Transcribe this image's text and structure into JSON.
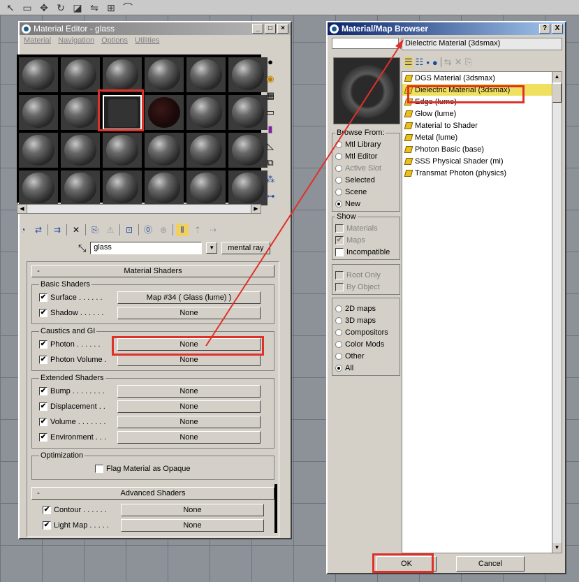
{
  "material_editor": {
    "title": "Material Editor - glass",
    "menus": [
      "Material",
      "Navigation",
      "Options",
      "Utilities"
    ],
    "material_name": "glass",
    "material_type": "mental ray",
    "rollouts": {
      "material_shaders": {
        "minus": "-",
        "title": "Material Shaders",
        "groups": [
          {
            "title": "Basic Shaders",
            "rows": [
              {
                "label": "Surface . . . . . .",
                "checked": "✔",
                "value": "Map #34  ( Glass (lume) )"
              },
              {
                "label": "Shadow . . . . . .",
                "checked": "✔",
                "value": "None"
              }
            ]
          },
          {
            "title": "Caustics and GI",
            "rows": [
              {
                "label": "Photon . . . . . .",
                "checked": "✔",
                "value": "None"
              },
              {
                "label": "Photon Volume .",
                "checked": "✔",
                "value": "None"
              }
            ]
          },
          {
            "title": "Extended Shaders",
            "rows": [
              {
                "label": "Bump . . . . . . . .",
                "checked": "✔",
                "value": "None"
              },
              {
                "label": "Displacement . .",
                "checked": "✔",
                "value": "None"
              },
              {
                "label": "Volume . . . . . . .",
                "checked": "✔",
                "value": "None"
              },
              {
                "label": "Environment . . .",
                "checked": "✔",
                "value": "None"
              }
            ]
          }
        ],
        "optimization": {
          "title": "Optimization",
          "label": "Flag Material as Opaque"
        }
      },
      "advanced_shaders": {
        "minus": "-",
        "title": "Advanced Shaders",
        "rows": [
          {
            "label": "Contour . . . . . .",
            "checked": "✔",
            "value": "None"
          },
          {
            "label": "Light Map . . . . .",
            "checked": "✔",
            "value": "None"
          }
        ]
      }
    }
  },
  "browser": {
    "title": "Material/Map Browser",
    "help_button": "?",
    "close_button": "X",
    "selected_name": "Dielectric Material (3dsmax)",
    "items": [
      "DGS Material (3dsmax)",
      "Dielectric Material (3dsmax)",
      "Edge (lume)",
      "Glow (lume)",
      "Material to Shader",
      "Metal (lume)",
      "Photon Basic (base)",
      "SSS Physical Shader (mi)",
      "Transmat Photon (physics)"
    ],
    "selected_index": 1,
    "browse_from": {
      "title": "Browse From:",
      "options": [
        {
          "label": "Mtl Library",
          "state": "off"
        },
        {
          "label": "Mtl Editor",
          "state": "off"
        },
        {
          "label": "Active Slot",
          "state": "disabled"
        },
        {
          "label": "Selected",
          "state": "off"
        },
        {
          "label": "Scene",
          "state": "off"
        },
        {
          "label": "New",
          "state": "on"
        }
      ]
    },
    "show": {
      "title": "Show",
      "options": [
        {
          "label": "Materials",
          "checked": "",
          "disabled": true
        },
        {
          "label": "Maps",
          "checked": "✔",
          "disabled": true
        },
        {
          "label": "Incompatible",
          "checked": "",
          "disabled": false
        }
      ]
    },
    "filters": [
      {
        "label": "Root Only",
        "disabled": true
      },
      {
        "label": "By Object",
        "disabled": true
      }
    ],
    "map_types": [
      {
        "label": "2D maps",
        "state": "off"
      },
      {
        "label": "3D maps",
        "state": "off"
      },
      {
        "label": "Compositors",
        "state": "off"
      },
      {
        "label": "Color Mods",
        "state": "off"
      },
      {
        "label": "Other",
        "state": "off"
      },
      {
        "label": "All",
        "state": "on"
      }
    ],
    "ok_label": "OK",
    "cancel_label": "Cancel"
  },
  "highlight_color": "#e0302a"
}
